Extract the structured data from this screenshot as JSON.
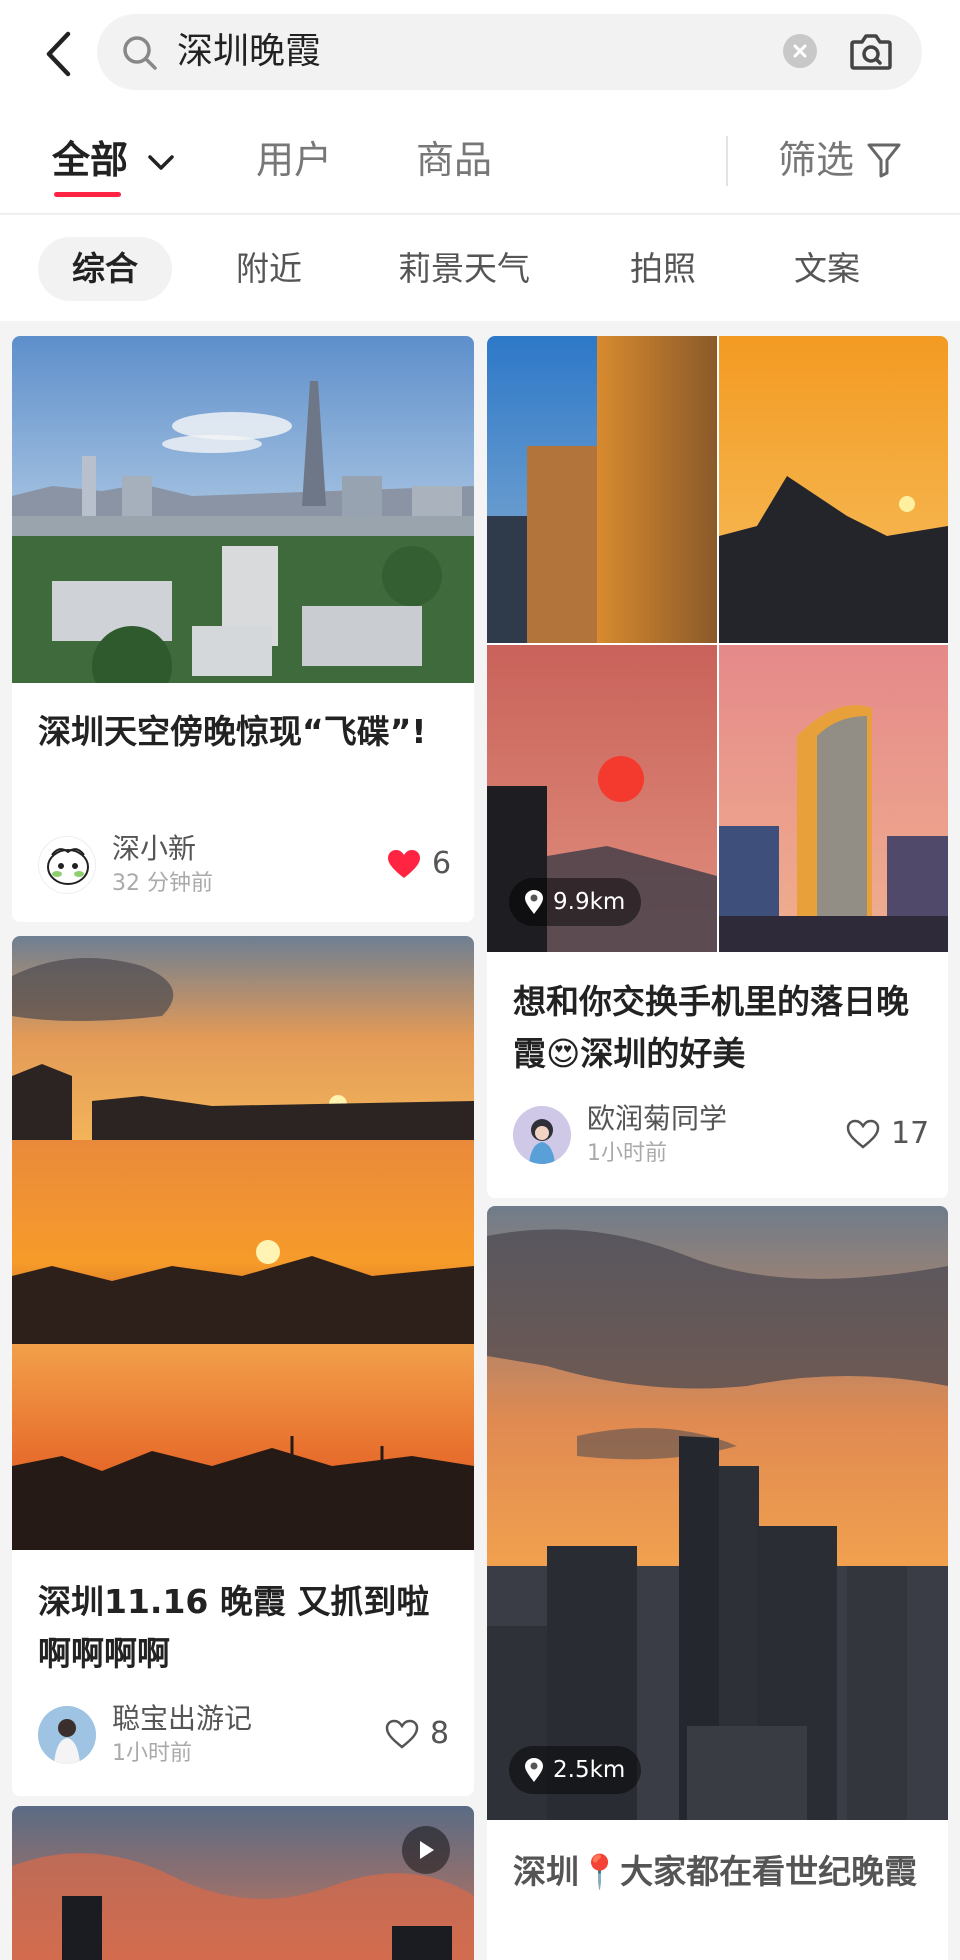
{
  "search": {
    "query": "深圳晚霞"
  },
  "tabs": [
    {
      "label": "全部",
      "active": true
    },
    {
      "label": "用户"
    },
    {
      "label": "商品"
    }
  ],
  "filter": {
    "label": "筛选"
  },
  "chips": [
    "综合",
    "附近",
    "莉景天气",
    "拍照",
    "文案"
  ],
  "accent_color": "#ff2442",
  "posts": [
    {
      "title": "深圳天空傍晚惊现“飞碟”!",
      "author": "深小新",
      "time": "32 分钟前",
      "likes": "6",
      "liked": true
    },
    {
      "title": "想和你交换手机里的落日晚霞😍深圳的好美",
      "author": "欧润菊同学",
      "time": "1小时前",
      "likes": "17",
      "distance": "9.9km"
    },
    {
      "title": "深圳11.16 晚霞 又抓到啦啊啊啊啊",
      "author": "聪宝出游记",
      "time": "1小时前",
      "likes": "8"
    },
    {
      "title": "深圳📍大家都在看世纪晚霞",
      "distance": "2.5km"
    }
  ]
}
